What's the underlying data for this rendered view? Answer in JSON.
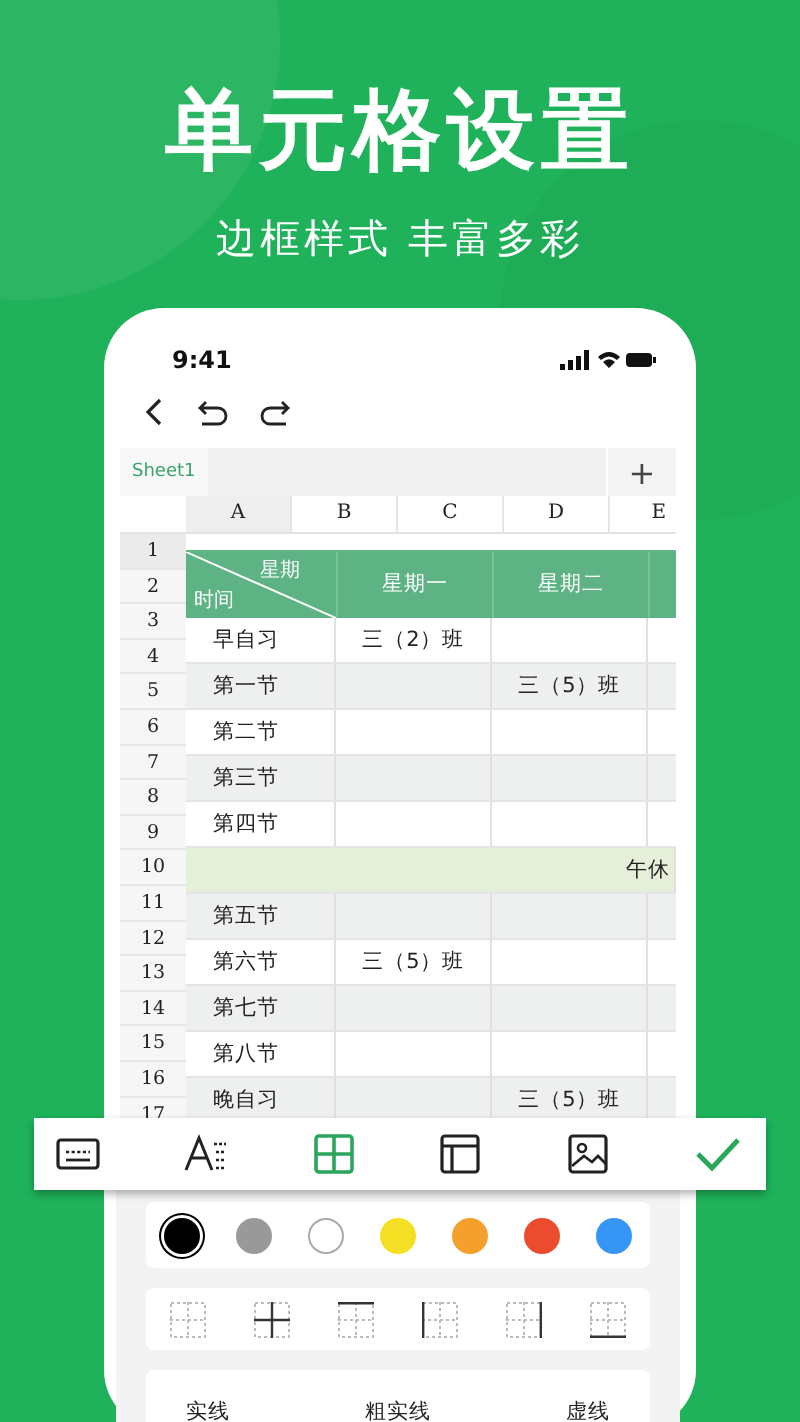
{
  "headline": "单元格设置",
  "subhead": "边框样式 丰富多彩",
  "status_bar": {
    "time": "9:41"
  },
  "sheet_tabs": [
    {
      "label": "Sheet1",
      "selected": true
    }
  ],
  "add_sheet": "+",
  "columns": [
    {
      "label": "A",
      "selected": true
    },
    {
      "label": "B",
      "selected": false
    },
    {
      "label": "C",
      "selected": false
    },
    {
      "label": "D",
      "selected": false
    },
    {
      "label": "E",
      "selected": false
    }
  ],
  "row_numbers": [
    "1",
    "2",
    "3",
    "4",
    "5",
    "6",
    "7",
    "8",
    "9",
    "10",
    "11",
    "12",
    "13",
    "14",
    "15",
    "16",
    "17"
  ],
  "table": {
    "corner_top": "星期",
    "corner_bottom": "时间",
    "days": [
      "星期一",
      "星期二"
    ],
    "rows": [
      {
        "kind": "lesson",
        "label": "早自习",
        "shaded": false,
        "monday": "三（2）班"
      },
      {
        "kind": "lesson",
        "label": "第一节",
        "shaded": true,
        "tuesday": "三（5）班"
      },
      {
        "kind": "lesson",
        "label": "第二节",
        "shaded": false
      },
      {
        "kind": "lesson",
        "label": "第三节",
        "shaded": true
      },
      {
        "kind": "lesson",
        "label": "第四节",
        "shaded": false
      },
      {
        "kind": "break",
        "label": "午休"
      },
      {
        "kind": "lesson",
        "label": "第五节",
        "shaded": true
      },
      {
        "kind": "lesson",
        "label": "第六节",
        "shaded": false,
        "monday": "三（5）班"
      },
      {
        "kind": "lesson",
        "label": "第七节",
        "shaded": true
      },
      {
        "kind": "lesson",
        "label": "第八节",
        "shaded": false
      },
      {
        "kind": "lesson",
        "label": "晚自习",
        "shaded": true,
        "tuesday": "三（5）班"
      }
    ]
  },
  "toolbar": [
    {
      "kind": "keyboard",
      "selected": false
    },
    {
      "kind": "text-format",
      "selected": false
    },
    {
      "kind": "borders",
      "selected": true
    },
    {
      "kind": "layout",
      "selected": false
    },
    {
      "kind": "image",
      "selected": false
    }
  ],
  "colors": [
    {
      "color": "#000000",
      "selected": true
    },
    {
      "color": "#999999",
      "selected": false
    },
    {
      "color": "#ffffff",
      "selected": false
    },
    {
      "color": "#f5df24",
      "selected": false
    },
    {
      "color": "#f4a02c",
      "selected": false
    },
    {
      "color": "#ec4c2e",
      "selected": false
    },
    {
      "color": "#3596f5",
      "selected": false
    }
  ],
  "border_options": [
    {
      "kind": "none"
    },
    {
      "kind": "inner"
    },
    {
      "kind": "top"
    },
    {
      "kind": "left"
    },
    {
      "kind": "right"
    },
    {
      "kind": "bottom"
    }
  ],
  "line_styles": [
    "实线",
    "粗实线",
    "虚线"
  ]
}
